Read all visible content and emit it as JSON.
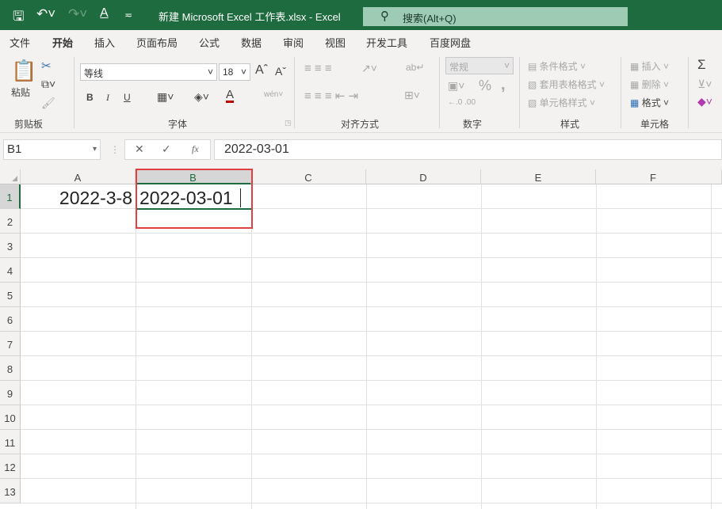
{
  "titlebar": {
    "title": "新建 Microsoft Excel 工作表.xlsx  -  Excel",
    "search_placeholder": "搜索(Alt+Q)"
  },
  "tabs": [
    "文件",
    "开始",
    "插入",
    "页面布局",
    "公式",
    "数据",
    "审阅",
    "视图",
    "开发工具",
    "百度网盘"
  ],
  "active_tab": "开始",
  "ribbon": {
    "clipboard": {
      "paste": "粘贴",
      "label": "剪贴板"
    },
    "font": {
      "name": "等线",
      "size": "18",
      "bold": "B",
      "italic": "I",
      "underline": "U",
      "label": "字体",
      "font_color": "#c00000"
    },
    "alignment": {
      "label": "对齐方式"
    },
    "number": {
      "format": "常规",
      "label": "数字",
      "percent": "%",
      "comma": ","
    },
    "styles": {
      "conditional": "条件格式",
      "table": "套用表格格式",
      "cell": "单元格样式",
      "label": "样式"
    },
    "cells": {
      "insert": "插入",
      "delete": "删除",
      "format": "格式",
      "label": "单元格"
    },
    "editing": {
      "sum": "Σ"
    }
  },
  "formula_bar": {
    "name_box": "B1",
    "value": "2022-03-01",
    "fx": "fx"
  },
  "columns": [
    "A",
    "B",
    "C",
    "D",
    "E",
    "F"
  ],
  "rows": [
    "1",
    "2",
    "3",
    "4",
    "5",
    "6",
    "7",
    "8",
    "9",
    "10",
    "11",
    "12",
    "13"
  ],
  "cells": {
    "A1": "2022-3-8",
    "B1": "2022-03-01"
  },
  "highlight_color": "#e04040"
}
